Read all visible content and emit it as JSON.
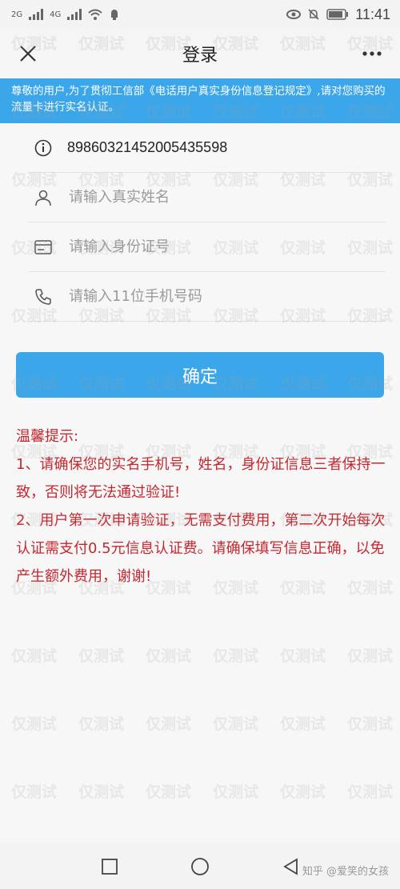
{
  "status_bar": {
    "network_left": "2G",
    "network_right": "4G",
    "time": "11:41"
  },
  "header": {
    "title": "登录",
    "close_icon": "close-icon",
    "more_icon": "more-icon"
  },
  "notice": {
    "text": "尊敬的用户,为了贯彻工信部《电话用户真实身份信息登记规定》,请对您购买的流量卡进行实名认证。"
  },
  "form": {
    "iccid_value": "89860321452005435598",
    "name_placeholder": "请输入真实姓名",
    "id_placeholder": "请输入身份证号",
    "phone_placeholder": "请输入11位手机号码"
  },
  "confirm_button": "确定",
  "tips": {
    "title": "温馨提示:",
    "line1": "1、请确保您的实名手机号，姓名，身份证信息三者保持一致，否则将无法通过验证!",
    "line2": "2、用户第一次申请验证，无需支付费用，第二次开始每次认证需支付0.5元信息认证费。请确保填写信息正确，以免产生额外费用，谢谢!"
  },
  "watermark_credit": "知乎 @爱笑的女孩",
  "watermark_tile": "仅测试",
  "colors": {
    "accent": "#3ba6ea",
    "tips_red": "#c6272f"
  }
}
